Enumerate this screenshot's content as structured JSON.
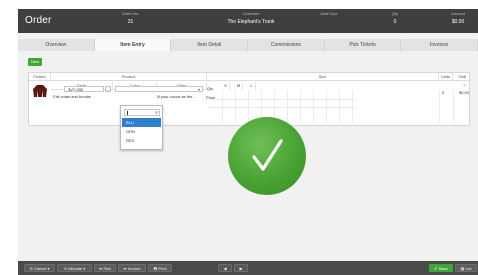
{
  "header": {
    "title": "Order",
    "columns": [
      {
        "label": "Order No.",
        "value": "31"
      },
      {
        "label": "Customer",
        "value": "The Elephant's Trunk"
      },
      {
        "label": "Date Due",
        "value": ""
      },
      {
        "label": "Qty",
        "value": "0"
      },
      {
        "label": "Amount",
        "value": "$0.00"
      }
    ]
  },
  "tabs": [
    {
      "label": "Overview",
      "active": false
    },
    {
      "label": "Item Entry",
      "active": true
    },
    {
      "label": "Item Detail",
      "active": false
    },
    {
      "label": "Commissions",
      "active": false
    },
    {
      "label": "Pick Tickets",
      "active": false
    },
    {
      "label": "Invoices",
      "active": false
    }
  ],
  "new_button": "New",
  "grid": {
    "headers": {
      "picture": "Picture",
      "product": "Product",
      "style": "Style",
      "color": "Color",
      "other": "Other",
      "size": "Size",
      "units": "Units",
      "total": "Total"
    },
    "sizes": [
      "S",
      "M",
      "L"
    ],
    "row": {
      "style_value": "3V7-030",
      "style_button": "...",
      "description": "Fall coats and boodie",
      "description_2": "ill your cocoa as the...",
      "qty_label": "Qty",
      "price_label": "Price",
      "units": "0",
      "total": "$0.00",
      "remove": "×"
    }
  },
  "dropdown": {
    "options": [
      "BLU",
      "GRN",
      "RED"
    ],
    "selected": "BLU"
  },
  "overlay": {
    "icon": "checkmark-icon",
    "color": "#49a233"
  },
  "bottom": {
    "cancel": "⊘ Cancel ▾",
    "allocate": "⊙ Allocate ▾",
    "pick": "➦ Pick",
    "invoice": "➦ Invoice",
    "print": "🖶 Print",
    "prev": "◀",
    "next": "▶",
    "save": "✔ Save",
    "list": "▦ List"
  }
}
